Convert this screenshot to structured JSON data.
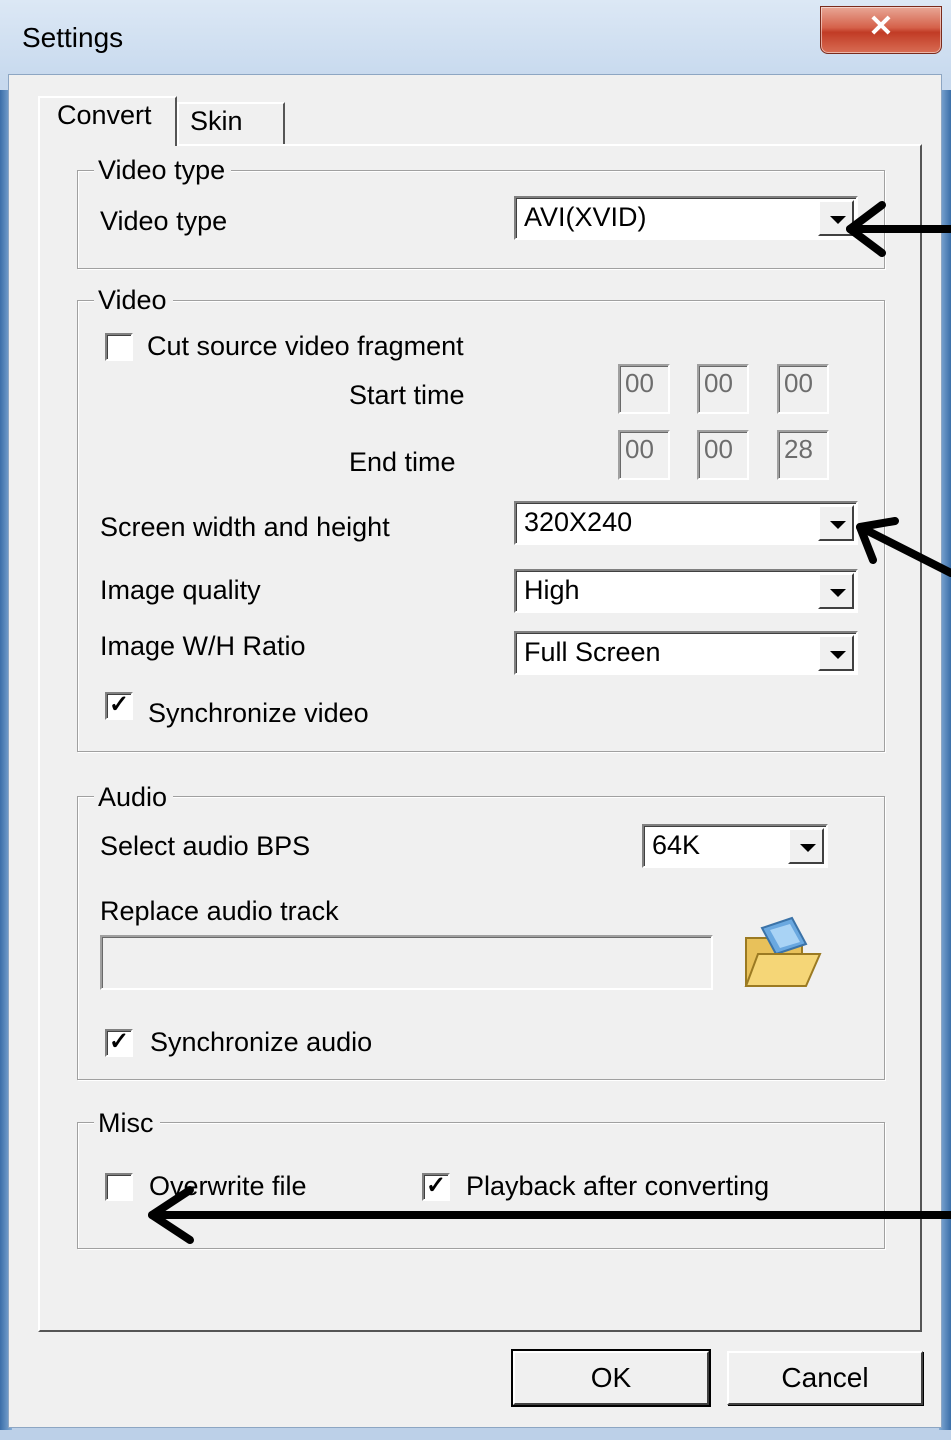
{
  "window": {
    "title": "Settings",
    "close_glyph": "✕"
  },
  "tabs": [
    {
      "label": "Convert",
      "active": true
    },
    {
      "label": "Skin",
      "active": false
    }
  ],
  "video_type_group": {
    "legend": "Video type",
    "label": "Video type",
    "value": "AVI(XVID)"
  },
  "video_group": {
    "legend": "Video",
    "cut_fragment": {
      "label": "Cut source video fragment",
      "checked": false
    },
    "start_time": {
      "label": "Start time",
      "h": "00",
      "m": "00",
      "s": "00"
    },
    "end_time": {
      "label": "End time",
      "h": "00",
      "m": "00",
      "s": "28"
    },
    "screen_size": {
      "label": "Screen width and height",
      "value": "320X240"
    },
    "image_quality": {
      "label": "Image quality",
      "value": "High"
    },
    "ratio": {
      "label": "Image W/H Ratio",
      "value": "Full Screen"
    },
    "sync_video": {
      "label": "Synchronize video",
      "checked": true,
      "mark": "✓"
    }
  },
  "audio_group": {
    "legend": "Audio",
    "bps": {
      "label": "Select audio BPS",
      "value": "64K"
    },
    "replace_track": {
      "label": "Replace audio track",
      "value": ""
    },
    "browse_icon": "open-folder-icon",
    "sync_audio": {
      "label": "Synchronize audio",
      "checked": true,
      "mark": "✓"
    }
  },
  "misc_group": {
    "legend": "Misc",
    "overwrite": {
      "label": "Overwrite file",
      "checked": false
    },
    "playback": {
      "label": "Playback after converting",
      "checked": true,
      "mark": "✓"
    }
  },
  "buttons": {
    "ok": "OK",
    "cancel": "Cancel"
  },
  "annotation_arrows": 3
}
